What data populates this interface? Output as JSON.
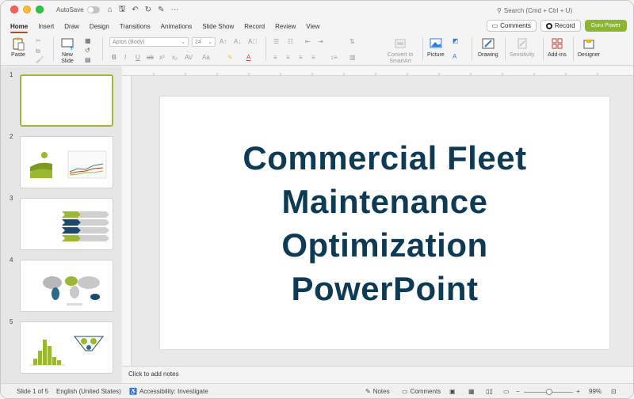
{
  "titlebar": {
    "autosave_label": "AutoSave",
    "search_placeholder": "Search (Cmd + Ctrl + U)"
  },
  "tabs": [
    {
      "label": "Home",
      "active": true
    },
    {
      "label": "Insert"
    },
    {
      "label": "Draw"
    },
    {
      "label": "Design"
    },
    {
      "label": "Transitions"
    },
    {
      "label": "Animations"
    },
    {
      "label": "Slide Show"
    },
    {
      "label": "Record"
    },
    {
      "label": "Review"
    },
    {
      "label": "View"
    }
  ],
  "tab_actions": {
    "comments": "Comments",
    "record": "Record",
    "guru": "Guru Power"
  },
  "ribbon": {
    "paste": "Paste",
    "new_slide": "New\nSlide",
    "font_name": "Aptos (Body)",
    "font_size": "24",
    "convert_smartart": "Convert to\nSmartArt",
    "picture": "Picture",
    "drawing": "Drawing",
    "sensitivity": "Sensitivity",
    "addins": "Add-ins",
    "designer": "Designer"
  },
  "thumbnails": [
    {
      "num": "1",
      "selected": true
    },
    {
      "num": "2"
    },
    {
      "num": "3"
    },
    {
      "num": "4"
    },
    {
      "num": "5"
    }
  ],
  "slide": {
    "title_lines": [
      "Commercial Fleet",
      "Maintenance",
      "Optimization",
      "PowerPoint"
    ]
  },
  "notes_placeholder": "Click to add notes",
  "status": {
    "slide_counter": "Slide 1 of 5",
    "language": "English (United States)",
    "accessibility": "Accessibility: Investigate",
    "notes": "Notes",
    "comments": "Comments",
    "zoom": "99%"
  },
  "colors": {
    "accent_green": "#8bb634",
    "title_navy": "#0d3a55",
    "tab_underline": "#b7472a"
  }
}
